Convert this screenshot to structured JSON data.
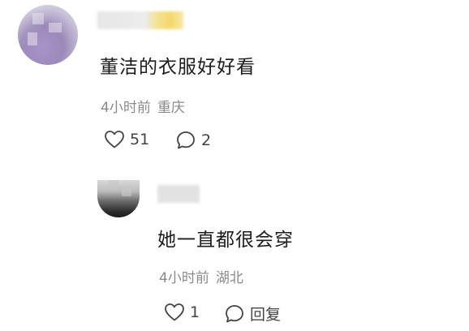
{
  "comments": [
    {
      "text": "董洁的衣服好好看",
      "time": "4小时前",
      "location": "重庆",
      "like_count": "51",
      "reply_count": "2",
      "like_icon": "heart-outline-icon",
      "reply_icon": "speech-bubble-icon"
    },
    {
      "text": "她一直都很会穿",
      "time": "4小时前",
      "location": "湖北",
      "like_count": "1",
      "reply_label": "回复",
      "like_icon": "heart-outline-icon",
      "reply_icon": "speech-bubble-icon"
    }
  ],
  "colors": {
    "text": "#1c1c1c",
    "meta": "#8a8a8a",
    "icon": "#444444",
    "background": "#ffffff"
  }
}
